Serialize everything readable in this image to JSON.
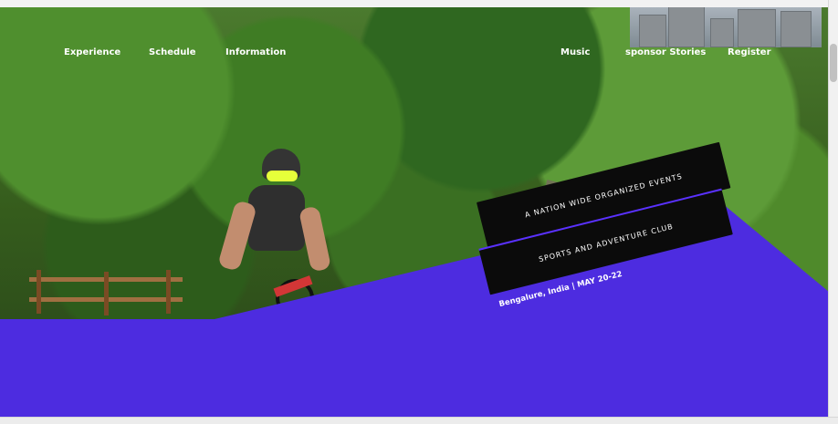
{
  "nav": {
    "left": [
      "Experience",
      "Schedule",
      "Information"
    ],
    "right": [
      "Music",
      "sponsor Stories",
      "Register"
    ]
  },
  "hero": {
    "line1": "A NATION WIDE ORGANIZED EVENTS",
    "line2": "SPORTS AND ADVENTURE CLUB",
    "line3": "Bengalure, India | MAY 20-22"
  },
  "colors": {
    "accent": "#4d2ce0",
    "dark": "#0b0b0b",
    "text": "#ffffff"
  }
}
